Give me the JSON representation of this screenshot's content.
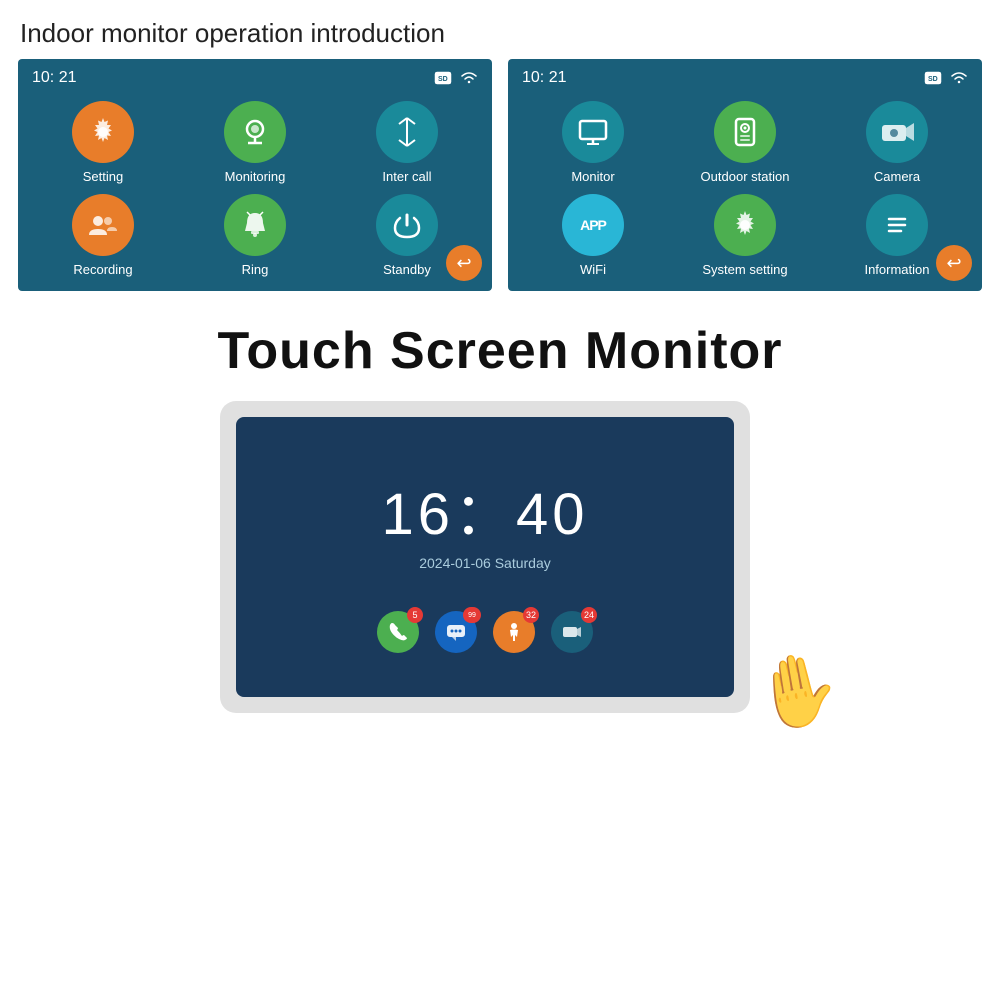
{
  "page": {
    "title": "Indoor monitor operation introduction",
    "bg_color": "#ffffff"
  },
  "screen_left": {
    "time": "10: 21",
    "icons": [
      {
        "label": "Setting",
        "color": "orange",
        "symbol": "⚙"
      },
      {
        "label": "Monitoring",
        "color": "green",
        "symbol": "📷"
      },
      {
        "label": "Inter call",
        "color": "teal-dark",
        "symbol": "⇅"
      },
      {
        "label": "Recording",
        "color": "orange",
        "symbol": "👥"
      },
      {
        "label": "Ring",
        "color": "green",
        "symbol": "🔔"
      },
      {
        "label": "Standby",
        "color": "teal-dark",
        "symbol": "⏻"
      }
    ]
  },
  "screen_right": {
    "time": "10: 21",
    "icons": [
      {
        "label": "Monitor",
        "color": "teal-dark",
        "symbol": "🖥"
      },
      {
        "label": "Outdoor station",
        "color": "green",
        "symbol": "📟"
      },
      {
        "label": "Camera",
        "color": "teal-dark",
        "symbol": "📸"
      },
      {
        "label": "WiFi",
        "color": "blue-bright",
        "symbol": "APP"
      },
      {
        "label": "System setting",
        "color": "green",
        "symbol": "⚙"
      },
      {
        "label": "Information",
        "color": "teal-dark",
        "symbol": "≡"
      }
    ]
  },
  "bottom": {
    "title": "Touch Screen Monitor",
    "clock": "16：40",
    "date": "2024-01-06  Saturday",
    "bottom_icons": [
      {
        "label": "phone",
        "color": "#4caf50",
        "symbol": "📞",
        "badge": "5"
      },
      {
        "label": "message",
        "color": "#1565c0",
        "symbol": "💬",
        "badge": "99"
      },
      {
        "label": "motion",
        "color": "#e87d2a",
        "symbol": "🚶",
        "badge": "32"
      },
      {
        "label": "camera",
        "color": "#1a5f7a",
        "symbol": "📹",
        "badge": "24"
      }
    ]
  }
}
